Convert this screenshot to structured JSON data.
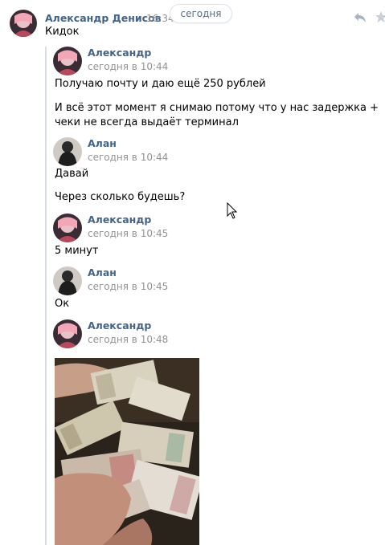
{
  "date_label": "сегодня",
  "message": {
    "author": "Александр Денисов",
    "time": "16:34",
    "text": "Кидок"
  },
  "forwarded": [
    {
      "author": "Александр",
      "time": "сегодня в 10:44",
      "lines": [
        "Получаю почту и даю ещё 250 рублей",
        "И всё этот момент я снимаю потому что у нас задержка +",
        "чеки не всегда выдаёт терминал"
      ]
    },
    {
      "author": "Алан",
      "time": "сегодня в 10:44",
      "lines": [
        "Давай",
        "Через сколько будешь?"
      ]
    },
    {
      "author": "Александр",
      "time": "сегодня в 10:45",
      "lines": [
        "5 минут"
      ]
    },
    {
      "author": "Алан",
      "time": "сегодня в 10:45",
      "lines": [
        "Ок"
      ]
    },
    {
      "author": "Александр",
      "time": "сегодня в 10:48",
      "lines": []
    }
  ],
  "icons": {
    "reply": "reply-icon",
    "star": "star-icon"
  }
}
